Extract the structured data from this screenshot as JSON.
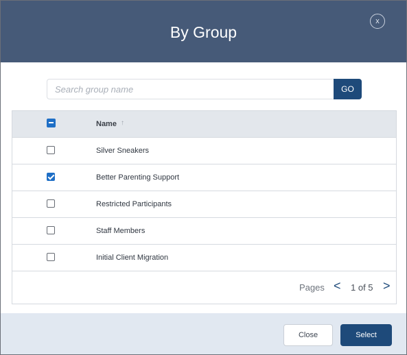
{
  "dialog": {
    "title": "By Group",
    "close_icon_text": "x"
  },
  "search": {
    "placeholder": "Search group name",
    "value": "",
    "go_label": "GO"
  },
  "table": {
    "header": {
      "name_label": "Name",
      "sort_icon": "↑",
      "select_all_state": "indeterminate"
    },
    "rows": [
      {
        "label": "Silver Sneakers",
        "checked": false
      },
      {
        "label": "Better Parenting Support",
        "checked": true
      },
      {
        "label": "Restricted Participants",
        "checked": false
      },
      {
        "label": "Staff Members",
        "checked": false
      },
      {
        "label": "Initial Client Migration",
        "checked": false
      }
    ]
  },
  "pagination": {
    "pages_label": "Pages",
    "prev_icon": "<",
    "page_info": "1 of 5",
    "next_icon": ">"
  },
  "footer": {
    "close_label": "Close",
    "select_label": "Select"
  },
  "colors": {
    "header_bg": "#465a78",
    "primary": "#1e4a7a",
    "checkbox_blue": "#1f6fc6",
    "footer_bg": "#e1e8f1",
    "table_header_bg": "#e3e7ec"
  }
}
